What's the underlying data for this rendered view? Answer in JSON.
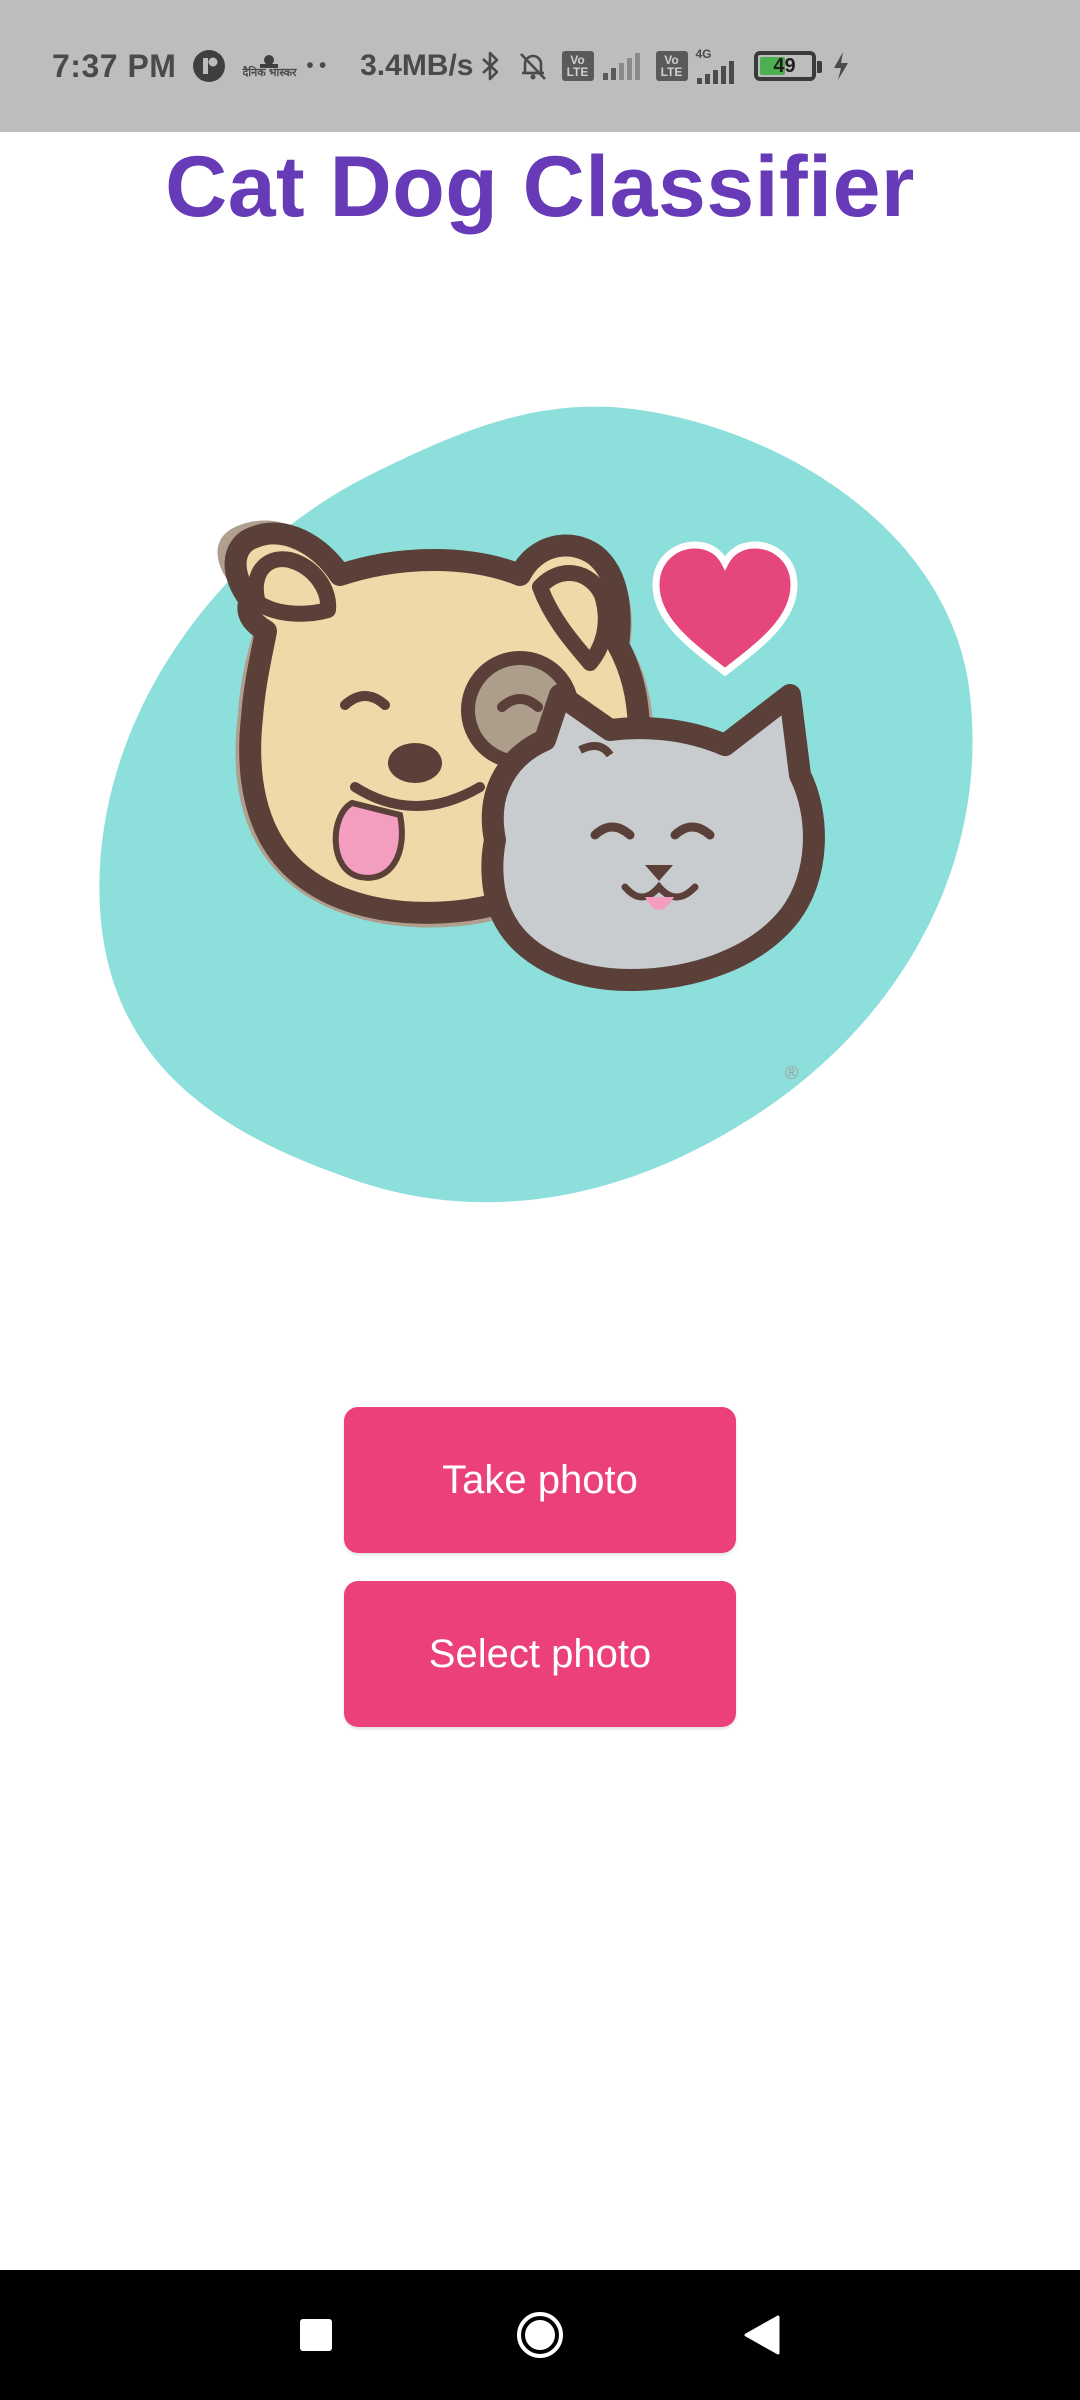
{
  "status_bar": {
    "time": "7:37 PM",
    "news_app_label": "दैनिक भास्कर",
    "more_dots": "• •",
    "network_speed": "3.4MB/s",
    "volte_1": "Vo LTE",
    "volte_2": "Vo LTE",
    "network_type": "4G",
    "battery_level": "49",
    "icons": [
      "app-notification-icon",
      "news-app-icon",
      "bluetooth-icon",
      "mute-bell-icon",
      "signal-icon",
      "battery-icon",
      "charging-bolt-icon"
    ]
  },
  "app": {
    "title": "Cat Dog Classifier",
    "title_color": "#673ab7"
  },
  "hero_image": {
    "name": "cat-dog-illustration",
    "registered_mark": "®",
    "colors": {
      "blob": "#8ddfdb",
      "dog": "#f0d9a8",
      "cat": "#c8cccf",
      "outline": "#5a4038",
      "heart": "#e5477d"
    }
  },
  "buttons": {
    "take_photo": "Take photo",
    "select_photo": "Select photo",
    "color": "#ec407a"
  },
  "nav_bar": {
    "items": [
      "recent-apps",
      "home",
      "back"
    ]
  }
}
